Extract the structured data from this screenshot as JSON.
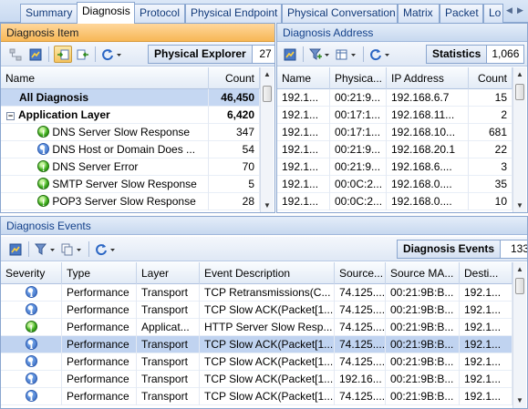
{
  "tabs": [
    {
      "label": "Summary",
      "active": false
    },
    {
      "label": "Diagnosis",
      "active": true
    },
    {
      "label": "Protocol",
      "active": false
    },
    {
      "label": "Physical Endpoint",
      "active": false
    },
    {
      "label": "Physical Conversation",
      "active": false
    },
    {
      "label": "Matrix",
      "active": false
    },
    {
      "label": "Packet",
      "active": false
    },
    {
      "label": "Lo",
      "active": false
    }
  ],
  "diagnosis_item": {
    "title": "Diagnosis Item",
    "physical_explorer_label": "Physical Explorer",
    "physical_explorer_value": "27",
    "columns": {
      "name": "Name",
      "count": "Count"
    },
    "rows": [
      {
        "name": "All Diagnosis",
        "count": "46,450",
        "kind": "all"
      },
      {
        "name": "Application Layer",
        "count": "6,420",
        "kind": "group"
      },
      {
        "name": "DNS Server Slow Response",
        "count": "347",
        "kind": "item",
        "icon": "ok"
      },
      {
        "name": "DNS Host or Domain Does ...",
        "count": "54",
        "kind": "item",
        "icon": "info"
      },
      {
        "name": "DNS Server Error",
        "count": "70",
        "kind": "item",
        "icon": "ok"
      },
      {
        "name": "SMTP Server Slow Response",
        "count": "5",
        "kind": "item",
        "icon": "ok"
      },
      {
        "name": "POP3 Server Slow Response",
        "count": "28",
        "kind": "item",
        "icon": "ok"
      }
    ]
  },
  "diagnosis_address": {
    "title": "Diagnosis Address",
    "statistics_label": "Statistics",
    "statistics_value": "1,066",
    "columns": {
      "name": "Name",
      "physical": "Physica...",
      "ip": "IP Address",
      "count": "Count"
    },
    "rows": [
      {
        "name": "192.1...",
        "physical": "00:21:9...",
        "ip": "192.168.6.7",
        "count": "15"
      },
      {
        "name": "192.1...",
        "physical": "00:17:1...",
        "ip": "192.168.11...",
        "count": "2"
      },
      {
        "name": "192.1...",
        "physical": "00:17:1...",
        "ip": "192.168.10...",
        "count": "681"
      },
      {
        "name": "192.1...",
        "physical": "00:21:9...",
        "ip": "192.168.20.1",
        "count": "22"
      },
      {
        "name": "192.1...",
        "physical": "00:21:9...",
        "ip": "192.168.6....",
        "count": "3"
      },
      {
        "name": "192.1...",
        "physical": "00:0C:2...",
        "ip": "192.168.0....",
        "count": "35"
      },
      {
        "name": "192.1...",
        "physical": "00:0C:2...",
        "ip": "192.168.0....",
        "count": "10"
      }
    ]
  },
  "diagnosis_events": {
    "title": "Diagnosis Events",
    "events_label": "Diagnosis Events",
    "events_value": "133",
    "columns": {
      "severity": "Severity",
      "type": "Type",
      "layer": "Layer",
      "description": "Event Description",
      "source": "Source...",
      "source_mac": "Source MA...",
      "dest": "Desti..."
    },
    "rows": [
      {
        "severity": "info",
        "type": "Performance",
        "layer": "Transport",
        "description": "TCP Retransmissions(C...",
        "source": "74.125....",
        "source_mac": "00:21:9B:B...",
        "dest": "192.1...",
        "selected": false
      },
      {
        "severity": "info",
        "type": "Performance",
        "layer": "Transport",
        "description": "TCP Slow ACK(Packet[1...",
        "source": "74.125....",
        "source_mac": "00:21:9B:B...",
        "dest": "192.1...",
        "selected": false
      },
      {
        "severity": "ok",
        "type": "Performance",
        "layer": "Applicat...",
        "description": "HTTP Server Slow Resp...",
        "source": "74.125....",
        "source_mac": "00:21:9B:B...",
        "dest": "192.1...",
        "selected": false
      },
      {
        "severity": "info",
        "type": "Performance",
        "layer": "Transport",
        "description": "TCP Slow ACK(Packet[1...",
        "source": "74.125....",
        "source_mac": "00:21:9B:B...",
        "dest": "192.1...",
        "selected": true
      },
      {
        "severity": "info",
        "type": "Performance",
        "layer": "Transport",
        "description": "TCP Slow ACK(Packet[1...",
        "source": "74.125....",
        "source_mac": "00:21:9B:B...",
        "dest": "192.1...",
        "selected": false
      },
      {
        "severity": "info",
        "type": "Performance",
        "layer": "Transport",
        "description": "TCP Slow ACK(Packet[1...",
        "source": "192.16...",
        "source_mac": "00:21:9B:B...",
        "dest": "192.1...",
        "selected": false
      },
      {
        "severity": "info",
        "type": "Performance",
        "layer": "Transport",
        "description": "TCP Slow ACK(Packet[1...",
        "source": "74.125....",
        "source_mac": "00:21:9B:B...",
        "dest": "192.1...",
        "selected": false
      }
    ]
  },
  "colors": {
    "orange_header": "#f7b756",
    "blue_header": "#c7d8ef",
    "selection": "#c0d3f0",
    "info_icon": "#2c5fb7",
    "ok_icon": "#3fae1e"
  }
}
